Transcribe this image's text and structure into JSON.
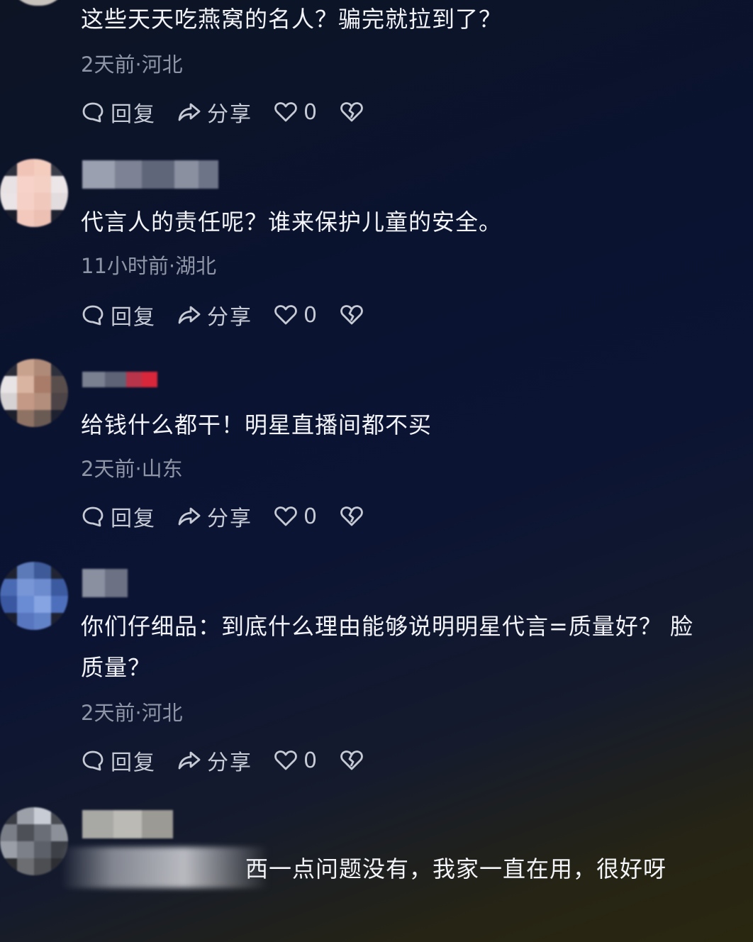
{
  "colors": {
    "text": "#f3f4f8",
    "meta": "#8e95a6",
    "action": "#c6cad4",
    "background_top": "#0a1330",
    "background_bottom": "#2a2710"
  },
  "comments": [
    {
      "text": "这些天天吃燕窝的名人？骗完就拉到了？",
      "meta": "2天前·河北",
      "reply_label": "回复",
      "share_label": "分享",
      "like_count": "0"
    },
    {
      "text": "代言人的责任呢？谁来保护儿童的安全。",
      "meta": "11小时前·湖北",
      "reply_label": "回复",
      "share_label": "分享",
      "like_count": "0"
    },
    {
      "text": "给钱什么都干！明星直播间都不买",
      "meta": "2天前·山东",
      "reply_label": "回复",
      "share_label": "分享",
      "like_count": "0"
    },
    {
      "text_line1": "你们仔细品：到底什么理由能够说明明星代言=质量好？ 脸",
      "text_line2": "质量？",
      "meta": "2天前·河北",
      "reply_label": "回复",
      "share_label": "分享",
      "like_count": "0"
    },
    {
      "text": "西一点问题没有，我家一直在用，很好呀"
    }
  ],
  "icons": {
    "reply": "comment-bubble-icon",
    "share": "share-arrow-icon",
    "like": "heart-icon",
    "dislike": "broken-heart-icon"
  }
}
